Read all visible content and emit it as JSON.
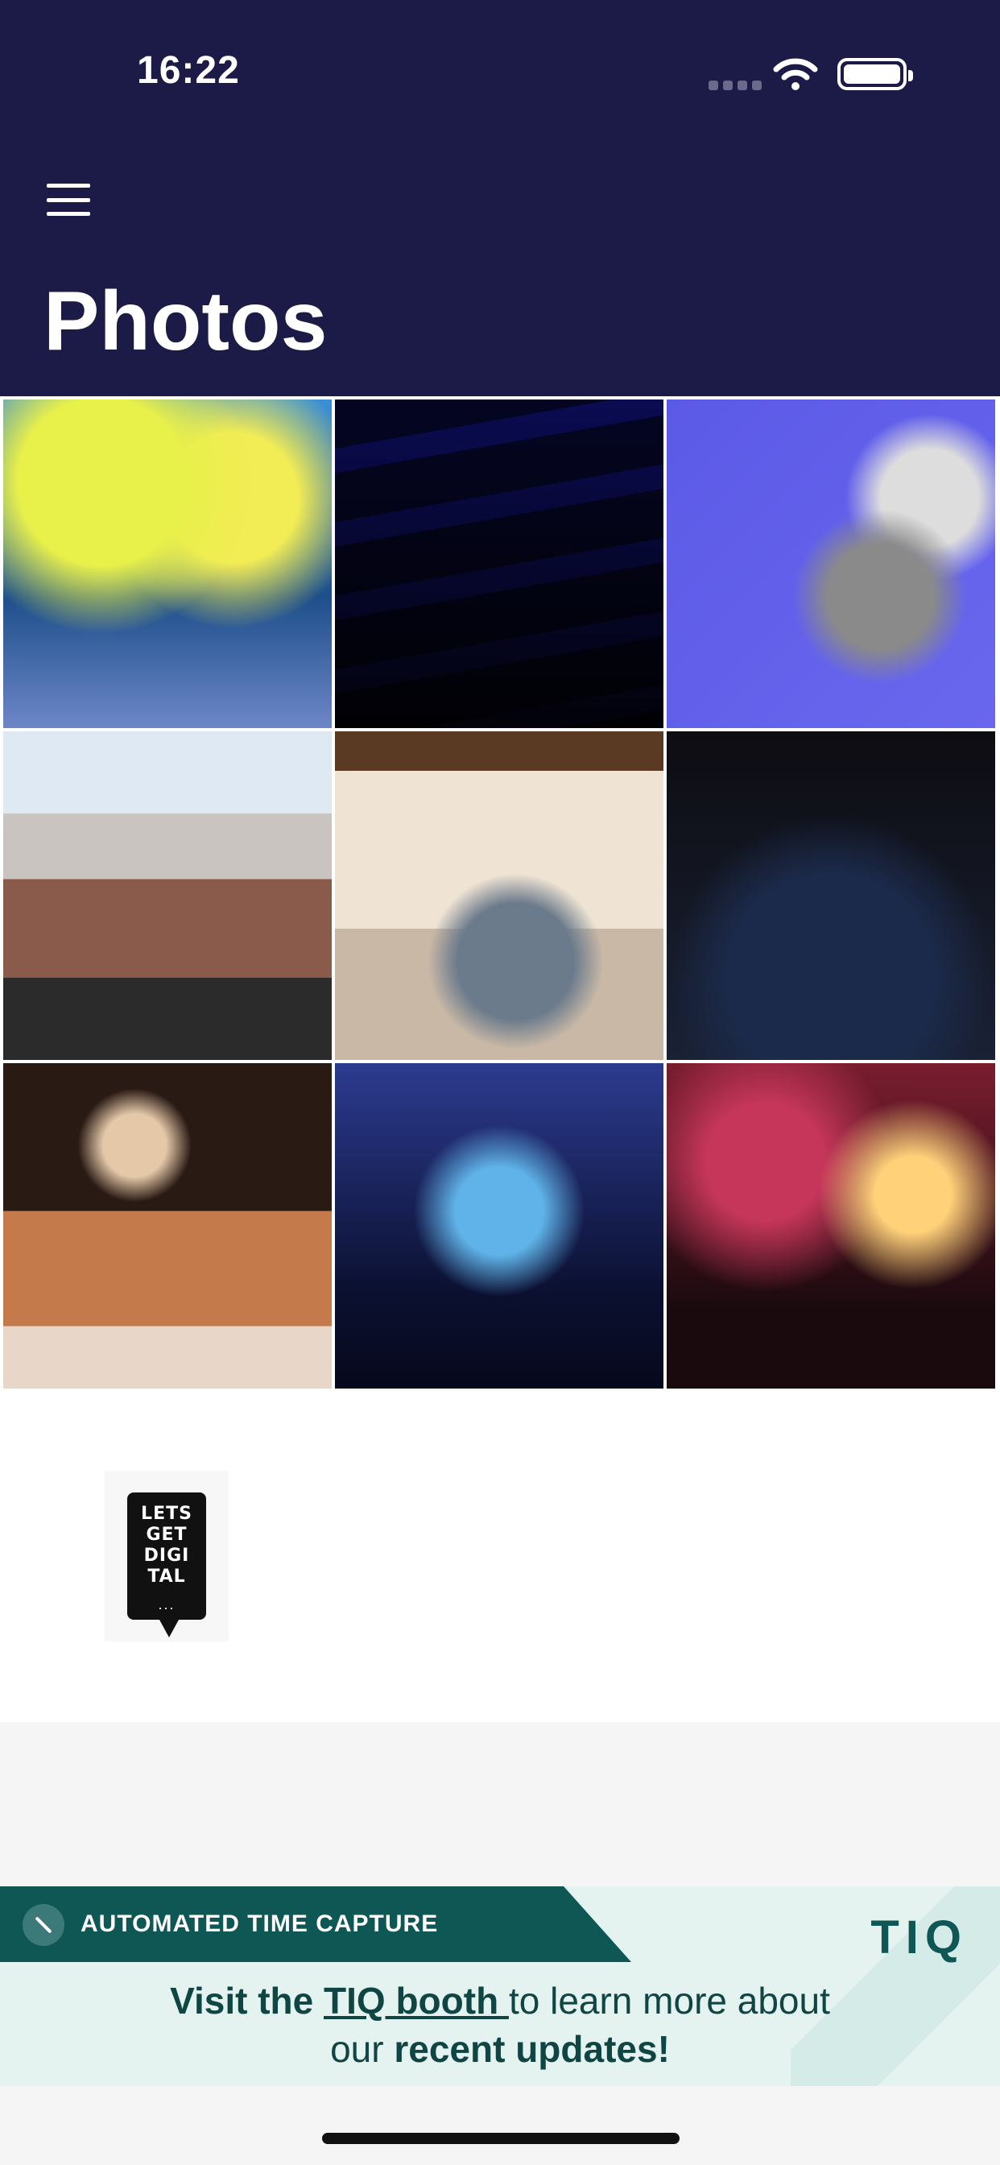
{
  "status_bar": {
    "time": "16:22"
  },
  "header": {
    "title": "Photos"
  },
  "photos": [
    {
      "description": ""
    },
    {
      "description": ""
    },
    {
      "description": ""
    },
    {
      "description": ""
    },
    {
      "description": ""
    },
    {
      "description": ""
    },
    {
      "description": ""
    },
    {
      "description": ""
    },
    {
      "description": ""
    }
  ],
  "logo": {
    "text": "LETS\nGET\nDIGI\nTAL",
    "dots": "..."
  },
  "banner": {
    "strip_text": "AUTOMATED TIME CAPTURE",
    "brand": "TIQ",
    "line1_prefix": "Visit the ",
    "line1_link": "TIQ booth ",
    "line1_suffix": "to learn more about",
    "line2_prefix": "our ",
    "line2_bold": "recent updates!"
  },
  "colors": {
    "header_bg": "#1c1b47",
    "banner_dark": "#0f5755",
    "banner_bg": "#e4f2f0"
  }
}
